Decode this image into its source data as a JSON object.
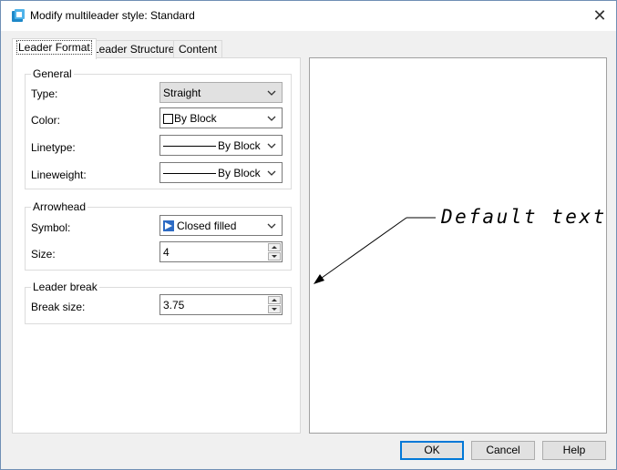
{
  "window": {
    "title": "Modify multileader style: Standard",
    "close_glyph": "✕"
  },
  "tabs": [
    {
      "label": "Leader Format",
      "active": true
    },
    {
      "label": "Leader Structure",
      "active": false
    },
    {
      "label": "Content",
      "active": false
    }
  ],
  "general": {
    "title": "General",
    "type_label": "Type:",
    "type_value": "Straight",
    "color_label": "Color:",
    "color_value": "By Block",
    "linetype_label": "Linetype:",
    "linetype_value": "By Block",
    "lineweight_label": "Lineweight:",
    "lineweight_value": "By Block"
  },
  "arrowhead": {
    "title": "Arrowhead",
    "symbol_label": "Symbol:",
    "symbol_value": "Closed filled",
    "size_label": "Size:",
    "size_value": "4"
  },
  "leader_break": {
    "title": "Leader break",
    "break_size_label": "Break size:",
    "break_size_value": "3.75"
  },
  "preview": {
    "text": "Default text"
  },
  "buttons": {
    "ok": "OK",
    "cancel": "Cancel",
    "help": "Help"
  },
  "colors": {
    "accent": "#0078d7",
    "arrow_symbol": "#2d6bc4",
    "app_icon": "#1e88c8"
  },
  "icons": [
    "app-icon",
    "close-icon",
    "chevron-down-icon",
    "spin-up-icon",
    "spin-down-icon"
  ]
}
